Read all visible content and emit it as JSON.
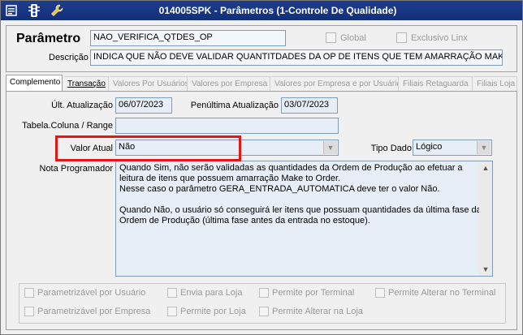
{
  "window": {
    "title": "014005SPK - Parâmetros (1-Controle De Qualidade)",
    "icons": [
      "window-menu-icon",
      "traffic-light-icon",
      "wrench-icon"
    ]
  },
  "header": {
    "parametro_label": "Parâmetro",
    "parametro_value": "NAO_VERIFICA_QTDES_OP",
    "descricao_label": "Descrição",
    "descricao_value": "INDICA QUE NÃO DEVE VALIDAR QUANTITDADES DA OP DE ITENS QUE TEM AMARRAÇÃO MAKE TO ORI",
    "global_label": "Global",
    "exclusivo_label": "Exclusivo Linx"
  },
  "tabs": [
    {
      "label": "Complemento",
      "state": "active"
    },
    {
      "label": "Transação",
      "state": "enabled"
    },
    {
      "label": "Valores Por Usuários",
      "state": "disabled"
    },
    {
      "label": "Valores por Empresa",
      "state": "disabled"
    },
    {
      "label": "Valores por Empresa e por Usuário",
      "state": "disabled"
    },
    {
      "label": "Filiais Retaguarda",
      "state": "disabled"
    },
    {
      "label": "Filiais Loja",
      "state": "disabled"
    }
  ],
  "complemento": {
    "ult_atualizacao_label": "Últ. Atualização",
    "ult_atualizacao_value": "06/07/2023",
    "penultima_label": "Penúltima Atualização",
    "penultima_value": "03/07/2023",
    "tabela_label": "Tabela.Coluna / Range",
    "tabela_value": "",
    "valor_atual_label": "Valor Atual",
    "valor_atual_value": "Não",
    "tipo_dado_label": "Tipo Dado",
    "tipo_dado_value": "Lógico",
    "nota_label": "Nota Programador",
    "nota_lines": [
      "Quando Sim, não serão validadas as quantidades da Ordem de Produção ao efetuar a",
      "leitura de itens que possuem amarração Make to Order.",
      "Nesse caso o parâmetro GERA_ENTRADA_AUTOMATICA deve ter o valor Não.",
      "",
      "Quando Não, o usuário só conseguirá ler itens que possuam quantidades da última fase da",
      "Ordem de Produção (última fase antes da entrada no estoque)."
    ]
  },
  "options": {
    "parametrizavel_usuario": "Parametrizável por Usuário",
    "envia_loja": "Envia para Loja",
    "permite_terminal": "Permite por Terminal",
    "permite_alterar_terminal": "Permite Alterar no Terminal",
    "parametrizavel_empresa": "Parametrizável por Empresa",
    "permite_loja": "Permite por Loja",
    "permite_alterar_loja": "Permite Alterar na Loja"
  },
  "colors": {
    "titlebar": "#1f3c8e",
    "highlight": "#e01818",
    "field_bg": "#e8eef7"
  }
}
